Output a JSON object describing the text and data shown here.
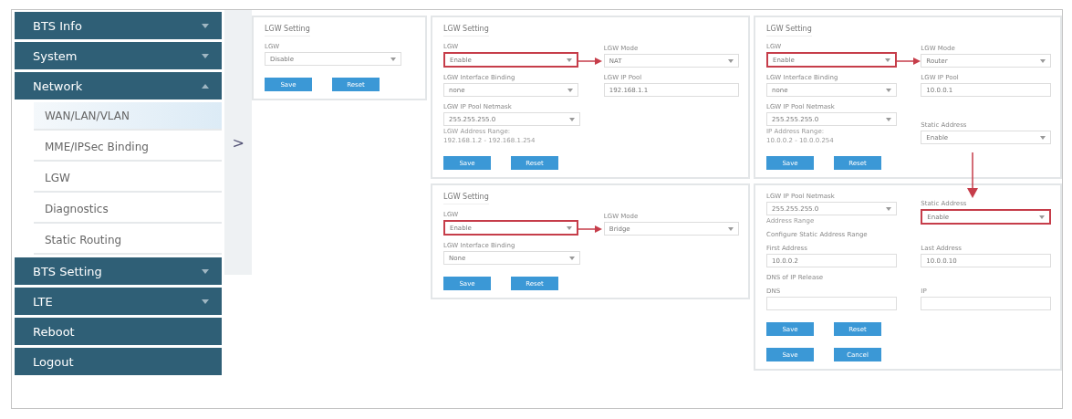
{
  "sidebar": {
    "items": [
      {
        "label": "BTS Info",
        "kind": "group",
        "expanded": false
      },
      {
        "label": "System",
        "kind": "group",
        "expanded": false
      },
      {
        "label": "Network",
        "kind": "group",
        "expanded": true,
        "children": [
          {
            "label": "WAN/LAN/VLAN",
            "selected": true
          },
          {
            "label": "MME/IPSec Binding",
            "selected": false
          },
          {
            "label": "LGW",
            "selected": false
          },
          {
            "label": "Diagnostics",
            "selected": false
          },
          {
            "label": "Static Routing",
            "selected": false
          }
        ]
      },
      {
        "label": "BTS Setting",
        "kind": "group",
        "expanded": false
      },
      {
        "label": "LTE",
        "kind": "group",
        "expanded": false
      },
      {
        "label": "Reboot",
        "kind": "link"
      },
      {
        "label": "Logout",
        "kind": "link"
      }
    ]
  },
  "expand_handle": ">",
  "columns": [
    {
      "panels": [
        {
          "title": "LGW Setting",
          "rows": [
            {
              "items": [
                {
                  "kind": "select",
                  "label": "LGW",
                  "value": "Disable"
                }
              ]
            }
          ],
          "buttons": [
            [
              "Save",
              "Reset"
            ]
          ]
        }
      ]
    },
    {
      "panels": [
        {
          "title": "LGW Setting",
          "rows": [
            {
              "arrow": true,
              "items": [
                {
                  "kind": "select",
                  "label": "LGW",
                  "value": "Enable",
                  "highlighted": true
                },
                {
                  "kind": "select",
                  "label": "LGW Mode",
                  "value": "NAT"
                }
              ]
            },
            {
              "items": [
                {
                  "kind": "select",
                  "label": "LGW Interface Binding",
                  "value": "none"
                },
                {
                  "kind": "input",
                  "label": "LGW IP Pool",
                  "value": "192.168.1.1"
                }
              ]
            },
            {
              "items": [
                {
                  "kind": "select",
                  "label": "LGW IP Pool Netmask",
                  "value": "255.255.255.0",
                  "hint": "LGW Address Range:",
                  "hint2": "192.168.1.2 - 192.168.1.254"
                }
              ]
            }
          ],
          "buttons": [
            [
              "Save",
              "Reset"
            ]
          ]
        },
        {
          "title": "LGW Setting",
          "rows": [
            {
              "arrow": true,
              "items": [
                {
                  "kind": "select",
                  "label": "LGW",
                  "value": "Enable",
                  "highlighted": true
                },
                {
                  "kind": "select",
                  "label": "LGW Mode",
                  "value": "Bridge"
                }
              ]
            },
            {
              "items": [
                {
                  "kind": "select",
                  "label": "LGW Interface Binding",
                  "value": "None"
                }
              ]
            }
          ],
          "buttons": [
            [
              "Save",
              "Reset"
            ]
          ]
        }
      ]
    },
    {
      "panels": [
        {
          "title": "LGW Setting",
          "rows": [
            {
              "arrow": true,
              "items": [
                {
                  "kind": "select",
                  "label": "LGW",
                  "value": "Enable",
                  "highlighted": true
                },
                {
                  "kind": "select",
                  "label": "LGW Mode",
                  "value": "Router"
                }
              ]
            },
            {
              "items": [
                {
                  "kind": "select",
                  "label": "LGW Interface Binding",
                  "value": "none"
                },
                {
                  "kind": "input",
                  "label": "LGW IP Pool",
                  "value": "10.0.0.1"
                }
              ]
            },
            {
              "items": [
                {
                  "kind": "select",
                  "label": "LGW IP Pool Netmask",
                  "value": "255.255.255.0",
                  "hint": "IP Address Range:",
                  "hint2": "10.0.0.2 - 10.0.0.254"
                },
                {
                  "kind": "select",
                  "label": "Static Address",
                  "value": "Enable"
                }
              ]
            }
          ],
          "buttons": [
            [
              "Save",
              "Reset"
            ]
          ],
          "down_arrow": true
        },
        {
          "rows": [
            {
              "items": [
                {
                  "kind": "select",
                  "label": "LGW IP Pool Netmask",
                  "value": "255.255.255.0",
                  "hint": "Address Range"
                },
                {
                  "kind": "select",
                  "label": "Static Address",
                  "value": "Enable",
                  "highlighted": true
                }
              ]
            },
            {
              "items": [
                {
                  "kind": "heading",
                  "label": "Configure Static Address Range"
                }
              ]
            },
            {
              "items": [
                {
                  "kind": "input",
                  "label": "First Address",
                  "value": "10.0.0.2"
                },
                {
                  "kind": "input",
                  "label": "Last Address",
                  "value": "10.0.0.10"
                }
              ]
            },
            {
              "items": [
                {
                  "kind": "heading",
                  "label": "DNS of IP Release"
                }
              ]
            },
            {
              "items": [
                {
                  "kind": "input",
                  "label": "DNS"
                },
                {
                  "kind": "input",
                  "label": "IP"
                }
              ]
            }
          ],
          "buttons": [
            [
              "Save",
              "Reset"
            ],
            [
              "Save",
              "Cancel"
            ]
          ]
        }
      ]
    }
  ]
}
